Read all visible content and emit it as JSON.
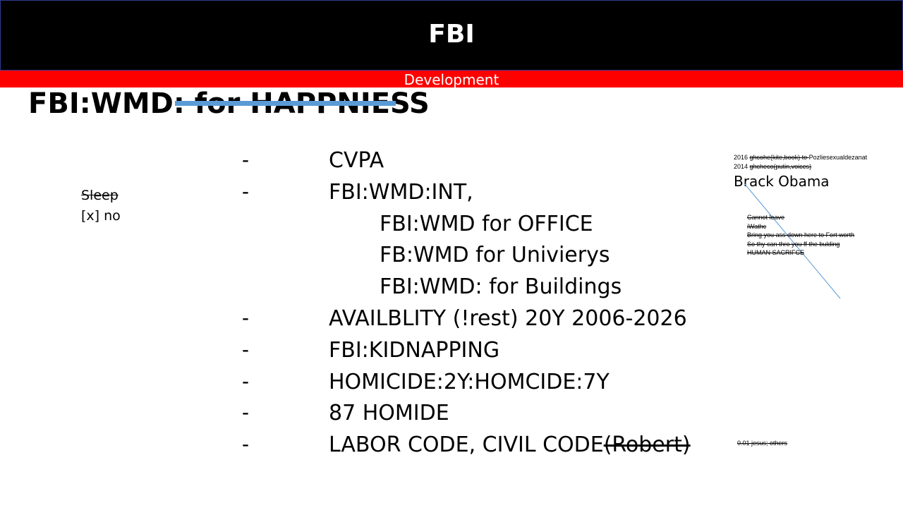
{
  "header": {
    "title": "FBI"
  },
  "subheader": {
    "label": "Development"
  },
  "main_title": {
    "prefix": "FBI:WMD: ",
    "struck": "for HAPPNIESS"
  },
  "bullets": [
    {
      "dash": "-",
      "text": "CVPA"
    },
    {
      "dash": "-",
      "text": "FBI:WMD:INT,"
    },
    {
      "dash": "-",
      "text": "AVAILBLITY  (!rest) 20Y 2006-2026"
    },
    {
      "dash": "-",
      "text": "FBI:KIDNAPPING"
    },
    {
      "dash": "-",
      "text": "HOMICIDE:2Y:HOMCIDE:7Y"
    },
    {
      "dash": "-",
      "text": "87 HOMIDE"
    },
    {
      "dash": "-",
      "text": "LABOR CODE, CIVIL CODE",
      "struck": "(Robert)"
    }
  ],
  "sub_bullets": [
    "FBI:WMD for OFFICE",
    "FB:WMD for Univierys",
    "FBI:WMD: for Buildings"
  ],
  "side_note": {
    "struck": "Sleep",
    "text": "[x] no"
  },
  "top_right": {
    "line1_year": "2016 ",
    "line1_struck": "ghcohe(kite,book) to ",
    "line1_rest": "Pozliesexualdezanat",
    "line2_year": "2014 ",
    "line2_struck": "ghcheco(putin,voices)",
    "name": "Brack Obama"
  },
  "struck_notes": [
    "Cannot leave",
    "iWathc",
    "Bring you ass down here to Fort worth",
    "So thy can thro you ff the bulding",
    "HUMAN SACRIFCE"
  ],
  "bottom_note": "0.01 jesus; others"
}
